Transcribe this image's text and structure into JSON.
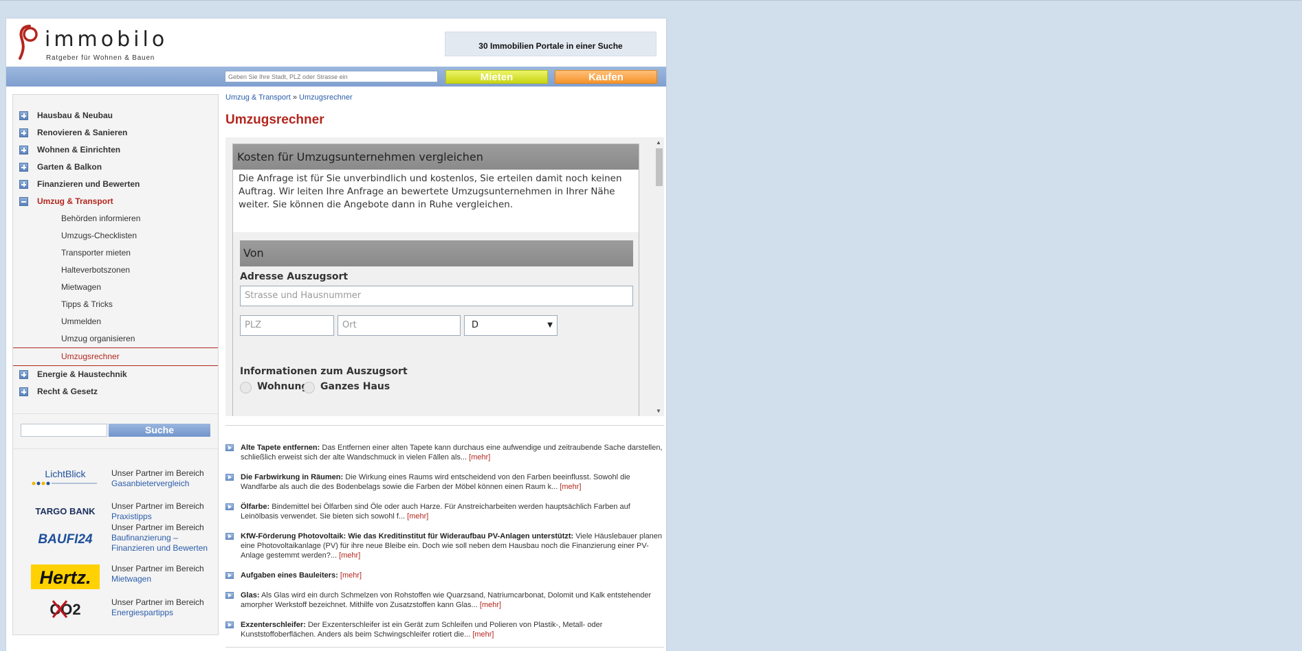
{
  "header": {
    "logo_word": "immobilo",
    "logo_tagline": "Ratgeber für Wohnen & Bauen",
    "promo_text": "30 Immobilien Portale in einer Suche"
  },
  "searchbar": {
    "placeholder": "Geben Sie Ihre Stadt, PLZ oder Strasse ein",
    "mieten_label": "Mieten",
    "kaufen_label": "Kaufen"
  },
  "sidebar": {
    "items_before": [
      {
        "label": "Hausbau & Neubau"
      },
      {
        "label": "Renovieren & Sanieren"
      },
      {
        "label": "Wohnen & Einrichten"
      },
      {
        "label": "Garten & Balkon"
      },
      {
        "label": "Finanzieren und Bewerten"
      }
    ],
    "active_item": {
      "label": "Umzug & Transport"
    },
    "sub_items": [
      {
        "label": "Behörden informieren"
      },
      {
        "label": "Umzugs-Checklisten"
      },
      {
        "label": "Transporter mieten"
      },
      {
        "label": "Halteverbotszonen"
      },
      {
        "label": "Mietwagen"
      },
      {
        "label": "Tipps & Tricks"
      },
      {
        "label": "Ummelden"
      },
      {
        "label": "Umzug organisieren"
      }
    ],
    "current_sub": {
      "label": "Umzugsrechner"
    },
    "items_after": [
      {
        "label": "Energie & Haustechnik"
      },
      {
        "label": "Recht & Gesetz"
      }
    ],
    "search_button": "Suche",
    "partners": [
      {
        "logo_text": "LichtBlick",
        "prefix": "Unser Partner im Bereich",
        "link": "Gasanbietervergleich"
      },
      {
        "logo_text": "TARGO BANK",
        "prefix": "Unser Partner im Bereich",
        "link": "Praxistipps"
      },
      {
        "logo_text": "BAUFI24",
        "prefix": "Unser Partner im Bereich",
        "link": "Baufinanzierung – Finanzieren und Bewerten"
      },
      {
        "logo_text": "Hertz.",
        "prefix": "Unser Partner im Bereich",
        "link": "Mietwagen"
      },
      {
        "logo_text": "CO2",
        "prefix": "Unser Partner im Bereich",
        "link": "Energiespartipps"
      }
    ]
  },
  "main": {
    "breadcrumb": {
      "first": "Umzug & Transport",
      "sep": "»",
      "second": "Umzugsrechner"
    },
    "title": "Umzugsrechner",
    "form": {
      "heading": "Kosten für Umzugsunternehmen vergleichen",
      "intro": "Die Anfrage ist für Sie unverbindlich und kostenlos, Sie erteilen damit noch keinen Auftrag. Wir leiten Ihre Anfrage an bewertete Umzugsunternehmen in Ihrer Nähe weiter. Sie können die Angebote dann in Ruhe vergleichen.",
      "section_von": "Von",
      "address_label": "Adresse Auszugsort",
      "street_placeholder": "Strasse und Hausnummer",
      "plz_placeholder": "PLZ",
      "ort_placeholder": "Ort",
      "country_value": "D",
      "info_label": "Informationen zum Auszugsort",
      "radio_1": "Wohnung",
      "radio_2": "Ganzes Haus"
    },
    "articles": [
      {
        "title": "Alte Tapete entfernen:",
        "text": " Das Entfernen einer alten Tapete kann durchaus eine aufwendige und zeitraubende Sache darstellen, schließlich erweist sich der alte Wandschmuck in vielen Fällen als... ",
        "more": "[mehr]"
      },
      {
        "title": "Die Farbwirkung in Räumen:",
        "text": " Die Wirkung eines Raums wird entscheidend von den Farben beeinflusst. Sowohl die Wandfarbe als auch die des Bodenbelags sowie die Farben der Möbel können einen Raum k... ",
        "more": "[mehr]"
      },
      {
        "title": "Ölfarbe:",
        "text": " Bindemittel bei Ölfarben sind Öle oder auch Harze. Für Anstreicharbeiten werden hauptsächlich Farben auf Leinölbasis verwendet. Sie bieten sich sowohl f... ",
        "more": "[mehr]"
      },
      {
        "title": "KfW-Förderung Photovoltaik: Wie das Kreditinstitut für Wideraufbau PV-Anlagen unterstützt:",
        "text": " Viele Häuslebauer planen eine Photovoltaikanlage (PV) für ihre neue Bleibe ein. Doch wie soll neben dem Hausbau noch die Finanzierung einer PV-Anlage gestemmt werden?... ",
        "more": "[mehr]"
      },
      {
        "title": "Aufgaben eines Bauleiters:",
        "text": " ",
        "more": "[mehr]"
      },
      {
        "title": "Glas:",
        "text": " Als Glas wird ein durch Schmelzen von Rohstoffen wie Quarzsand, Natriumcarbonat, Dolomit und Kalk entstehender amorpher Werkstoff bezeichnet. Mithilfe von Zusatzstoffen kann Glas... ",
        "more": "[mehr]"
      },
      {
        "title": "Exzenterschleifer:",
        "text": " Der Exzenterschleifer ist ein Gerät zum Schleifen und Polieren von Plastik-, Metall- oder Kunststoffoberflächen. Anders als beim Schwingschleifer rotiert die... ",
        "more": "[mehr]"
      }
    ]
  },
  "colors": {
    "accent_red": "#b3261e",
    "bar_blue": "#8aa9d6",
    "mieten": "#d4e02a",
    "kaufen": "#f7a040"
  }
}
